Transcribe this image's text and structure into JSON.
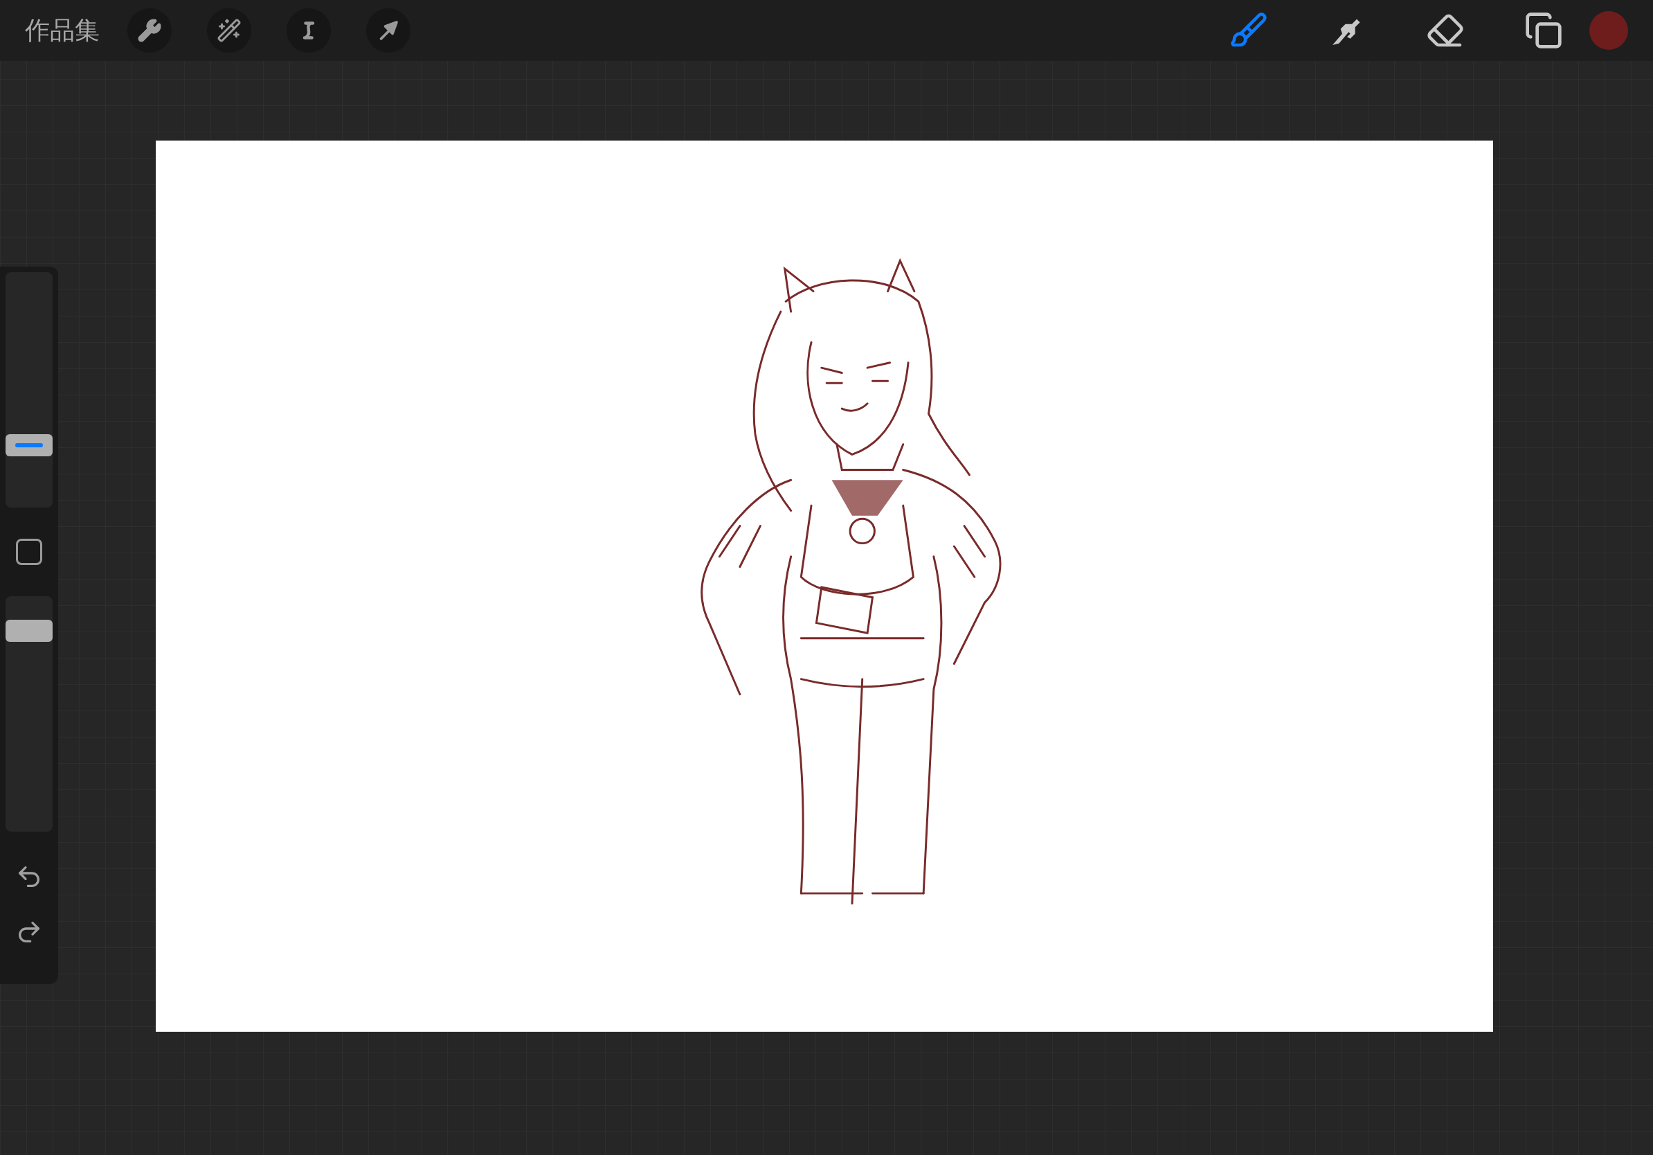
{
  "toolbar": {
    "gallery_label": "作品集",
    "actions": [
      {
        "kind": "adjust"
      },
      {
        "kind": "wand"
      },
      {
        "kind": "select"
      },
      {
        "kind": "transform"
      }
    ],
    "tools": [
      {
        "kind": "paint",
        "selected": true
      },
      {
        "kind": "smudge",
        "selected": false
      },
      {
        "kind": "erase",
        "selected": false
      },
      {
        "kind": "layers",
        "selected": false
      }
    ],
    "color": "#6e1c1c"
  },
  "sidebar": {
    "brush_size": {
      "level": 0.24
    },
    "opacity": {
      "level": 0.89
    }
  }
}
